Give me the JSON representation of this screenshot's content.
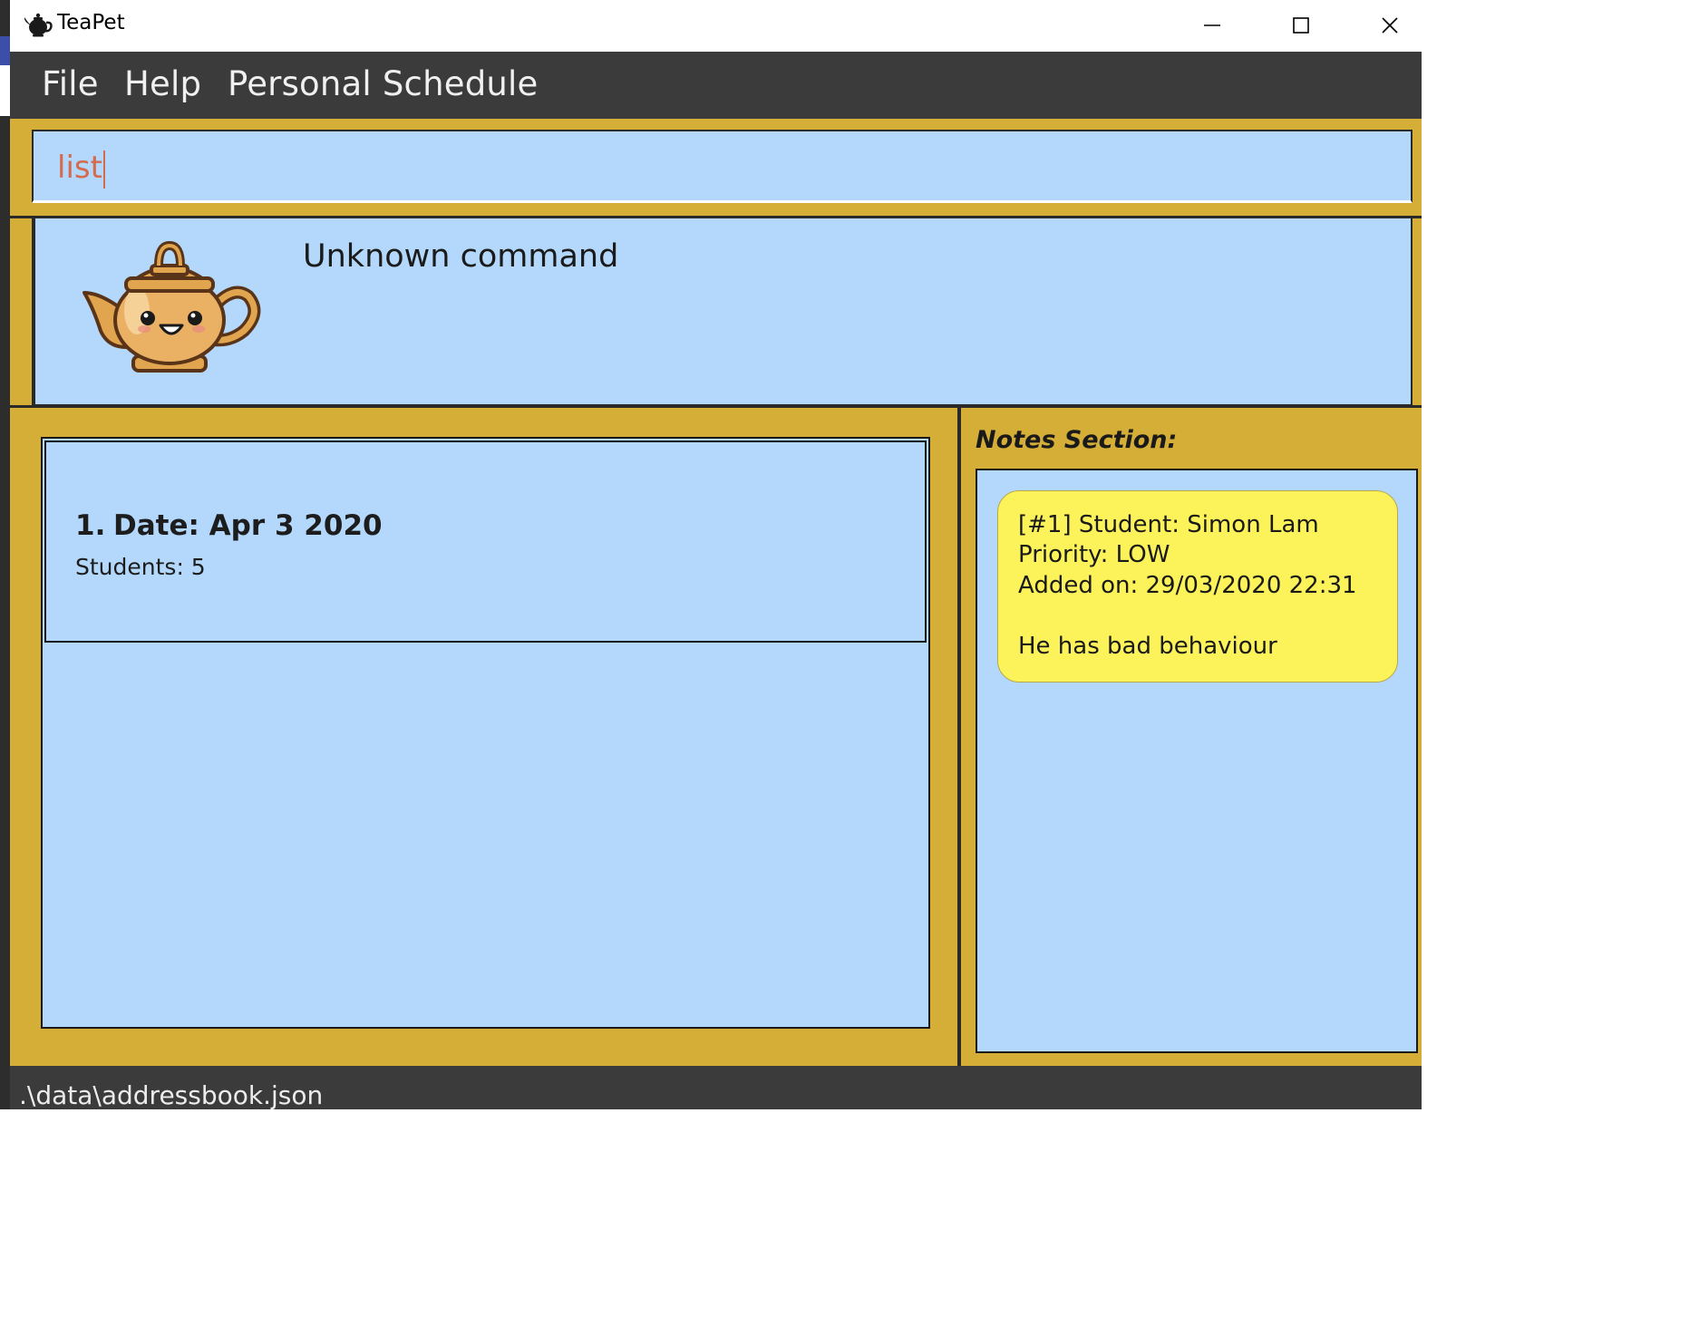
{
  "window": {
    "title": "TeaPet",
    "icon": "teapot-icon",
    "controls": [
      "minimize-icon",
      "maximize-icon",
      "close-icon"
    ]
  },
  "menu": {
    "file": "File",
    "help": "Help",
    "schedule": "Personal Schedule"
  },
  "command": {
    "value": "list"
  },
  "result": {
    "message": "Unknown command",
    "mascot": "teapot-mascot-icon"
  },
  "schedule_list": {
    "items": [
      {
        "index": "1.",
        "date": "Date: Apr 3 2020",
        "students": "Students: 5"
      }
    ]
  },
  "notes": {
    "header": "Notes Section:",
    "items": [
      {
        "line1": "[#1] Student: Simon Lam",
        "line2": "Priority: LOW",
        "line3": "Added on: 29/03/2020 22:31",
        "content": "He has bad behaviour"
      }
    ]
  },
  "status": {
    "path": ".\\data\\addressbook.json"
  },
  "colors": {
    "accent": "#d4ae37",
    "panel": "#b3d8fb",
    "note": "#fcf35a",
    "bar": "#3b3b3b",
    "command_text": "#d46a4e"
  }
}
